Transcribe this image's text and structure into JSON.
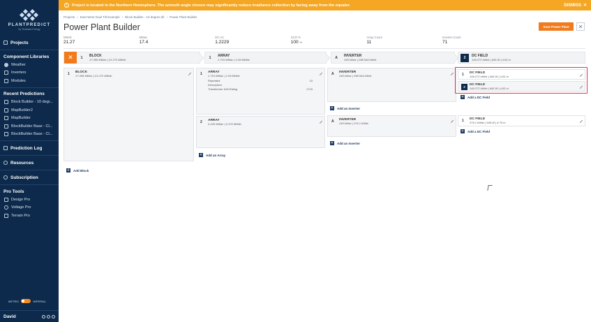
{
  "sidebar": {
    "logo_title": "PLANTPREDICT",
    "logo_subtitle": "by Terabase Energy",
    "projects": "Projects",
    "component_libraries": "Component Libraries",
    "library_items": [
      "Weather",
      "Inverters",
      "Modules"
    ],
    "recent_predictions": "Recent Predictions",
    "recent_items": [
      "Block Builder - 10 degr...",
      "MapBuilder2",
      "MapBuilder",
      "BlockBuilder Base - Cl...",
      "BlockBuilder Base - Cl..."
    ],
    "prediction_log": "Prediction Log",
    "resources": "Resources",
    "subscription": "Subscription",
    "pro_tools": "Pro Tools",
    "pro_items": [
      "Design Pro",
      "Voltage Pro",
      "Terrain Pro"
    ],
    "units": {
      "metric": "METRIC",
      "imperial": "IMPERIAL"
    },
    "user": "David"
  },
  "alert": {
    "text": "Project is located in the Northern Hemisphere. The azimuth angle chosen may significantly reduce irradiance collection by facing away from the equator.",
    "dismiss": "DISMISS"
  },
  "breadcrumb": [
    "Projects",
    "East-West Dual Tilt Example",
    "Block Builder - 10 degree tilt",
    "Power Plant Builder"
  ],
  "page_title": "Power Plant Builder",
  "save_button": "Save Power Plant",
  "stats": [
    {
      "label": "MWdc",
      "value": "21.27"
    },
    {
      "label": "MWac",
      "value": "17.4"
    },
    {
      "label": "DC:AC",
      "value": "1.2229"
    },
    {
      "label": "GCR %",
      "value": "100",
      "unit": "%"
    },
    {
      "label": "Array Count",
      "value": "11"
    },
    {
      "label": "Inverter Count",
      "value": "71"
    }
  ],
  "column_headers": {
    "block": {
      "num": "1",
      "title": "BLOCK",
      "sub": "17.395 MWac | 21.272 MWdc"
    },
    "array": {
      "num": "1",
      "title": "ARRAY",
      "sub": "1.715 MWac | 2.09 MWdc"
    },
    "inverter": {
      "num": "A",
      "title": "INVERTER",
      "sub": "245 kWac | 298.544 kWdc"
    },
    "dc_field": {
      "num": "2",
      "title": "DC FIELD",
      "sub": "149.272 kWdc | 645 W | 4.81 m"
    }
  },
  "blocks": [
    {
      "num": "1",
      "title": "BLOCK",
      "sub": "17.395 MWac | 21.272 MWdc"
    }
  ],
  "add_block": "Add Block",
  "arrays": [
    {
      "num": "1",
      "title": "ARRAY",
      "sub": "1.715 MWac | 2.09 MWdc",
      "props": [
        {
          "label": "Repeated",
          "value": "10"
        },
        {
          "label": "Description",
          "value": ""
        },
        {
          "label": "Transformer kVA Rating",
          "value": "1715"
        }
      ]
    },
    {
      "num": "2",
      "title": "ARRAY",
      "sub": "0.245 MWac | 0.374 MWdc"
    }
  ],
  "add_array": "Add an Array",
  "inverters": [
    {
      "num": "A",
      "title": "INVERTER",
      "sub": "245 kWac | 298.544 kWdc"
    },
    {
      "num": "A",
      "title": "INVERTER",
      "sub": "245 kWac | 374.1 kWdc"
    }
  ],
  "add_inverter": "Add an Inverter",
  "dc_fields_group1": [
    {
      "num": "1",
      "title": "DC FIELD",
      "sub": "149.272 kWdc | 645 W | 4.81 m"
    },
    {
      "num": "2",
      "title": "DC FIELD",
      "sub": "149.272 kWdc | 645 W | 4.81 m"
    }
  ],
  "dc_fields_group2": [
    {
      "num": "1",
      "title": "DC FIELD",
      "sub": "374.1 kWdc | 645 W | 4.79 m"
    }
  ],
  "add_dc_field": "Add a DC Field",
  "colors": {
    "sidebar": "#0d2a4c",
    "alert": "#f5a623",
    "accent": "#f07a1c",
    "highlight": "#e0384a"
  }
}
